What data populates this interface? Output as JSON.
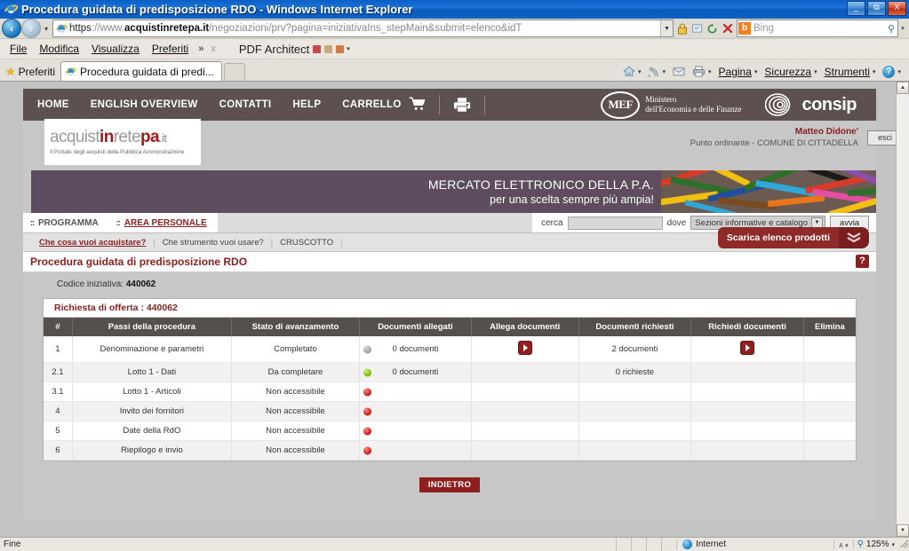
{
  "window": {
    "title": "Procedura guidata di predisposizione RDO - Windows Internet Explorer",
    "minimize": "_",
    "restore": "&#10697;",
    "close": "X"
  },
  "address": {
    "scheme": "https",
    "sep": "://www.",
    "host": "acquistinretepa.it",
    "rest": "/negoziazioni/prv?pagina=iniziativaIns_stepMain&submit=elenco&idT",
    "dropdown_caret": "▼",
    "lock_icon": "lock-icon",
    "refresh_icon": "refresh-icon",
    "stop_icon": "X",
    "search_provider": "b",
    "search_placeholder": "Bing",
    "search_icon": "⌕"
  },
  "menu": {
    "items": [
      "File",
      "Modifica",
      "Visualizza",
      "Preferiti"
    ],
    "overflow": "»",
    "close": "x",
    "pdf_architect": "PDF Architect",
    "pdf_caret": "▾"
  },
  "tabs": {
    "favorites_label": "Preferiti",
    "active_tab": "Procedura guidata di predi...",
    "commands": [
      "Pagina",
      "Sicurezza",
      "Strumenti"
    ],
    "caret": "▾",
    "help_icon": "?"
  },
  "site": {
    "topnav": [
      "HOME",
      "ENGLISH OVERVIEW",
      "CONTATTI",
      "HELP",
      "CARRELLO"
    ],
    "cart_icon": "cart-icon",
    "print_icon": "printer-icon",
    "mef_abbr": "MEF",
    "mef_line1": "Ministero",
    "mef_line2": "dell'Economia e delle Finanze",
    "consip_name": "consip",
    "logo": {
      "part1": "acquist",
      "part2": "in",
      "part3": "rete",
      "part4": "pa",
      "part5": ".it",
      "tagline": "Il Portale degli acquisti della Pubblica Amministrazione"
    },
    "user": {
      "name": "Matteo Didone'",
      "role": "Punto ordinante - COMUNE DI CITTADELLA",
      "logout": "esci"
    },
    "banner": {
      "line1": "MERCATO ELETTRONICO DELLA P.A.",
      "line2": "per una scelta sempre più ampia!"
    },
    "nav_tabs": [
      {
        "label": "PROGRAMMA",
        "active": false
      },
      {
        "label": "AREA PERSONALE",
        "active": true
      }
    ],
    "search": {
      "cerca_label": "cerca",
      "cerca_value": "",
      "dove_label": "dove",
      "dove_selected": "Sezioni informative e catalogo",
      "submit_label": "avvia"
    },
    "subnav": [
      {
        "label": "Che cosa vuoi acquistare?",
        "hot": true
      },
      {
        "label": "Che strumento vuoi usare?",
        "hot": false
      },
      {
        "label": "CRUSCOTTO",
        "hot": false
      }
    ],
    "subnav_sep": "|",
    "download_button": "Scarica elenco prodotti",
    "download_chevron": "»"
  },
  "page": {
    "title": "Procedura guidata di predisposizione RDO",
    "help_icon": "?",
    "codice_label": "Codice iniziativa:",
    "codice_value": "440062",
    "rdo_title": "Richiesta di offerta : 440062",
    "back_button": "INDIETRO"
  },
  "table": {
    "headers": [
      "#",
      "Passi della procedura",
      "Stato di avanzamento",
      "Documenti allegati",
      "Allega documenti",
      "Documenti richiesti",
      "Richiedi documenti",
      "Elimina"
    ],
    "rows": [
      {
        "num": "1",
        "step": "Denominazione e parametri",
        "dot": "grey",
        "status": "Completato",
        "docs_attached": "0 documenti",
        "attach_action": true,
        "docs_required": "2 documenti",
        "request_action": true,
        "delete_action": false
      },
      {
        "num": "2.1",
        "step": "Lotto 1 - Dati",
        "dot": "green",
        "status": "Da completare",
        "docs_attached": "0 documenti",
        "attach_action": false,
        "docs_required": "0 richieste",
        "request_action": false,
        "delete_action": false
      },
      {
        "num": "3.1",
        "step": "Lotto 1 - Articoli",
        "dot": "red",
        "status": "Non accessibile",
        "docs_attached": "",
        "attach_action": false,
        "docs_required": "",
        "request_action": false,
        "delete_action": false
      },
      {
        "num": "4",
        "step": "Invito dei fornitori",
        "dot": "red",
        "status": "Non accessibile",
        "docs_attached": "",
        "attach_action": false,
        "docs_required": "",
        "request_action": false,
        "delete_action": false
      },
      {
        "num": "5",
        "step": "Date della RdO",
        "dot": "red",
        "status": "Non accessibile",
        "docs_attached": "",
        "attach_action": false,
        "docs_required": "",
        "request_action": false,
        "delete_action": false
      },
      {
        "num": "6",
        "step": "Riepilogo e invio",
        "dot": "red",
        "status": "Non accessibile",
        "docs_attached": "",
        "attach_action": false,
        "docs_required": "",
        "request_action": false,
        "delete_action": false
      }
    ]
  },
  "statusbar": {
    "text": "Fine",
    "zone": "Internet",
    "zoom": "125%",
    "zoom_caret": "▾",
    "a_icon": "ᴀ",
    "a_caret": "▾"
  },
  "colors": {
    "brand_red": "#8a1f1f",
    "topnav": "#5c514f",
    "banner": "#5e4d5e",
    "table_header": "#55504e",
    "status_green": "#6cba12",
    "status_red": "#cc1111",
    "status_grey": "#9a9a9a"
  }
}
